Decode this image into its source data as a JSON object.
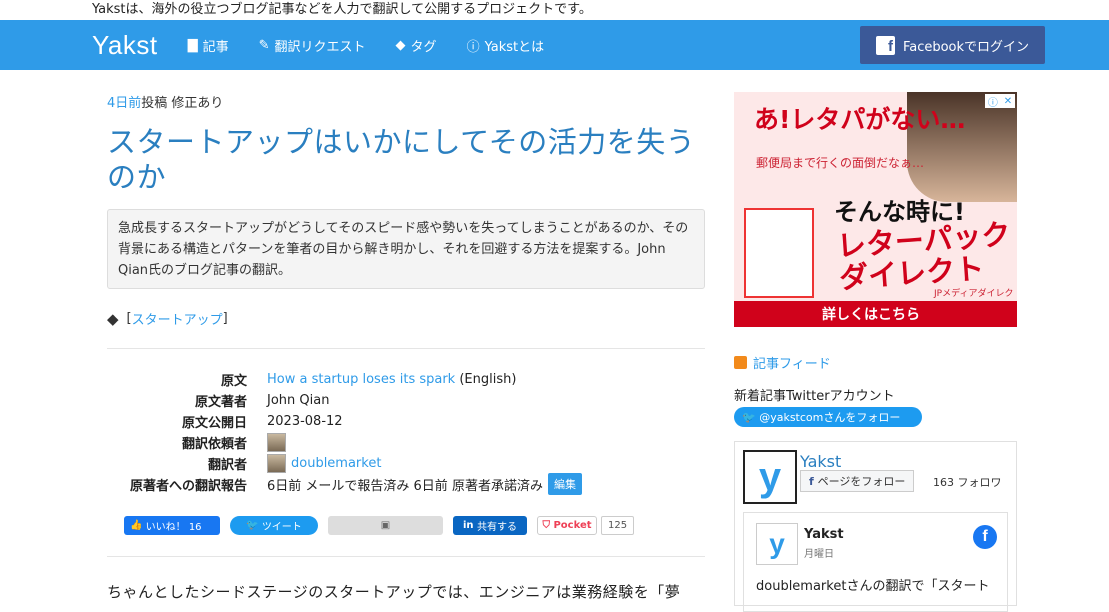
{
  "topnote": "Yakstは、海外の役立つブログ記事などを人力で翻訳して公開するプロジェクトです。",
  "nav": {
    "brand": "Yakst",
    "items": [
      {
        "label": "記事",
        "icon": "document-icon"
      },
      {
        "label": "翻訳リクエスト",
        "icon": "pencil-icon"
      },
      {
        "label": "タグ",
        "icon": "tags-icon"
      },
      {
        "label": "Yakstとは",
        "icon": "info-icon"
      }
    ],
    "facebook_login": "Facebookでログイン"
  },
  "article": {
    "posted_ago": "4日前",
    "posted_suffix": "投稿 修正あり",
    "title": "スタートアップはいかにしてその活力を失うのか",
    "summary": "急成長するスタートアップがどうしてそのスピード感や勢いを失ってしまうことがあるのか、その背景にある構造とパターンを筆者の目から解き明かし、それを回避する方法を提案する。John Qian氏のブログ記事の翻訳。",
    "tag": "スタートアップ",
    "info": {
      "original_label": "原文",
      "original_link": "How a startup loses its spark",
      "original_lang": "(English)",
      "author_label": "原文著者",
      "author": "John Qian",
      "published_label": "原文公開日",
      "published": "2023-08-12",
      "requester_label": "翻訳依頼者",
      "translator_label": "翻訳者",
      "translator": "doublemarket",
      "report_label": "原著者への翻訳報告",
      "report": "6日前 メールで報告済み 6日前 原著者承諾済み",
      "edit": "編集"
    },
    "social": {
      "like": "いいね！ 16",
      "tweet": "ツイート",
      "share": "共有する",
      "pocket": "Pocket",
      "pocket_count": "125"
    },
    "body_start": "ちゃんとしたシードステージのスタートアップでは、エンジニアは業務経験を「夢"
  },
  "sidebar": {
    "ad": {
      "line1": "あ!レタパがない…",
      "line2": "郵便局まで行くの面倒だなぁ…",
      "line3": "そんな時に!",
      "line4": "レターパックダイレクト",
      "brand": "JPメディアダイレクト",
      "cta": "詳しくはこちら"
    },
    "feed_label": "記事フィード",
    "twitter_label": "新着記事Twitterアカウント",
    "twitter_follow": "@yakstcomさんをフォロー",
    "fb": {
      "name": "Yakst",
      "follow": "ページをフォロー",
      "count": "163 フォロワ",
      "post_name": "Yakst",
      "post_day": "月曜日",
      "post_text": "doublemarketさんの翻訳で「スタート"
    }
  },
  "colors": {
    "accent": "#2f9be8",
    "facebook": "#3b5998",
    "ad_red": "#d0021b"
  }
}
